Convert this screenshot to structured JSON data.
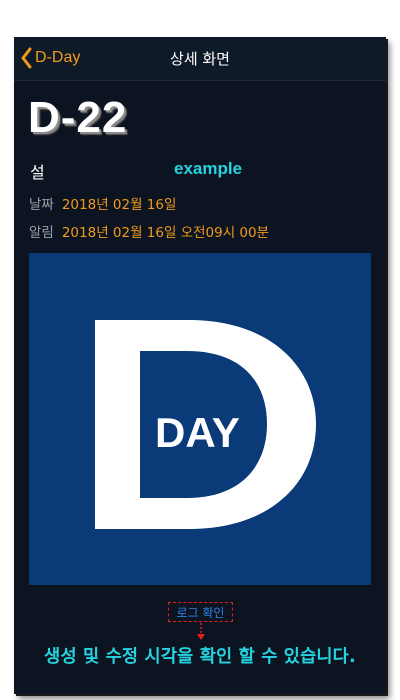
{
  "navbar": {
    "back_label": "D-Day",
    "title": "상세 화면"
  },
  "detail": {
    "dday": "D-22",
    "category": "설",
    "name": "example",
    "date_label": "날짜",
    "date_value": "2018년 02월 16일",
    "alarm_label": "알림",
    "alarm_value": "2018년 02월 16일 오전09시 00분"
  },
  "image": {
    "logo_text": "DAY",
    "icon": "d-day-logo-icon"
  },
  "log_button": {
    "label": "로그 확인"
  },
  "annotation": {
    "caption": "생성 및 수정 시각을 확인 할 수 있습니다."
  },
  "colors": {
    "background": "#0b1420",
    "accent_orange": "#f29a19",
    "accent_cyan": "#27d3e0",
    "link_blue": "#2e86e8",
    "image_blue": "#0b3a78",
    "annotation_red": "#e0201f"
  }
}
